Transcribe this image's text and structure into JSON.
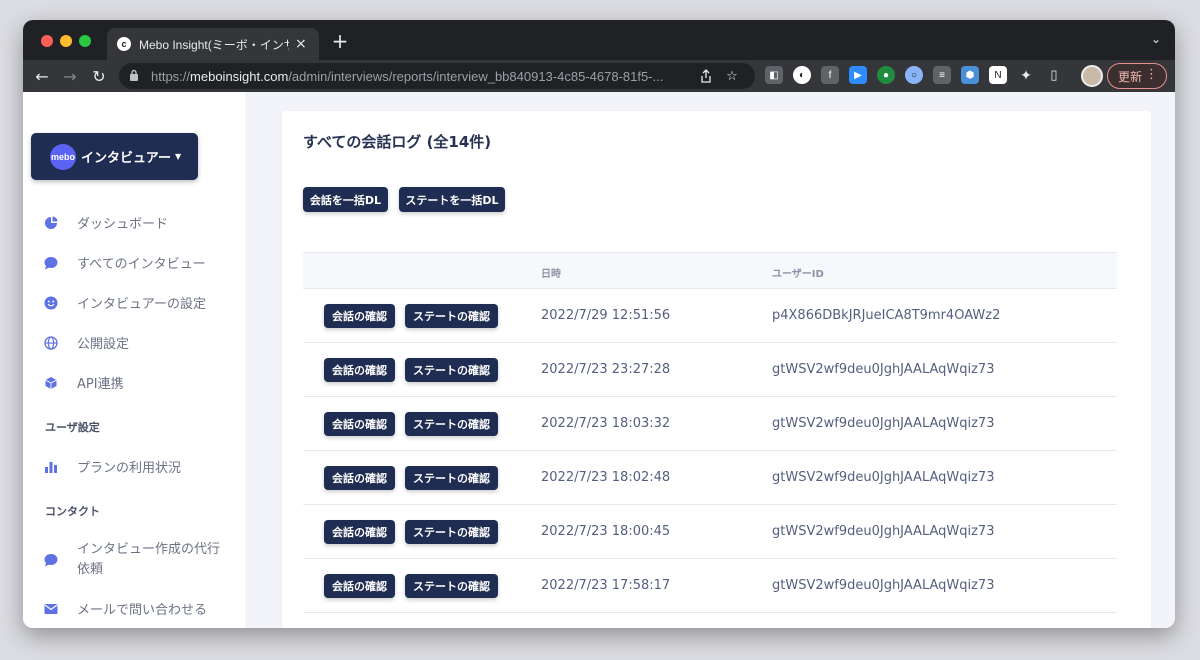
{
  "browser": {
    "tab_title": "Mebo Insight(ミーボ・インサイ",
    "favicon_letter": "c",
    "url_prefix": "https://",
    "url_host": "meboinsight.com",
    "url_path": "/admin/interviews/reports/interview_bb840913-4c85-4678-81f5-...",
    "update_label": "更新"
  },
  "sidebar": {
    "interviewer_logo": "mebo",
    "interviewer_label": "インタビュアー",
    "items": [
      {
        "label": "ダッシュボード"
      },
      {
        "label": "すべてのインタビュー"
      },
      {
        "label": "インタビュアーの設定"
      },
      {
        "label": "公開設定"
      },
      {
        "label": "API連携"
      }
    ],
    "user_section": "ユーザ設定",
    "user_items": [
      {
        "label": "プランの利用状況"
      }
    ],
    "contact_section": "コンタクト",
    "contact_items": [
      {
        "label_line1": "インタビュー作成の代行",
        "label_line2": "依頼"
      },
      {
        "label": "メールで問い合わせる"
      }
    ]
  },
  "main": {
    "title": "すべての会話ログ (全14件)",
    "bulk_conversation_dl": "会話を一括DL",
    "bulk_state_dl": "ステートを一括DL",
    "columns": [
      "",
      "日時",
      "ユーザーID"
    ],
    "row_btn_conversation": "会話の確認",
    "row_btn_state": "ステートの確認",
    "rows": [
      {
        "datetime": "2022/7/29 12:51:56",
        "user_id": "p4X866DBkJRJueICA8T9mr4OAWz2"
      },
      {
        "datetime": "2022/7/23 23:27:28",
        "user_id": "gtWSV2wf9deu0JghJAALAqWqiz73"
      },
      {
        "datetime": "2022/7/23 18:03:32",
        "user_id": "gtWSV2wf9deu0JghJAALAqWqiz73"
      },
      {
        "datetime": "2022/7/23 18:02:48",
        "user_id": "gtWSV2wf9deu0JghJAALAqWqiz73"
      },
      {
        "datetime": "2022/7/23 18:00:45",
        "user_id": "gtWSV2wf9deu0JghJAALAqWqiz73"
      },
      {
        "datetime": "2022/7/23 17:58:17",
        "user_id": "gtWSV2wf9deu0JghJAALAqWqiz73"
      }
    ]
  },
  "colors": {
    "navy": "#1f2d52",
    "accent": "#5b63f5",
    "icon_blue": "#5e72e4"
  }
}
